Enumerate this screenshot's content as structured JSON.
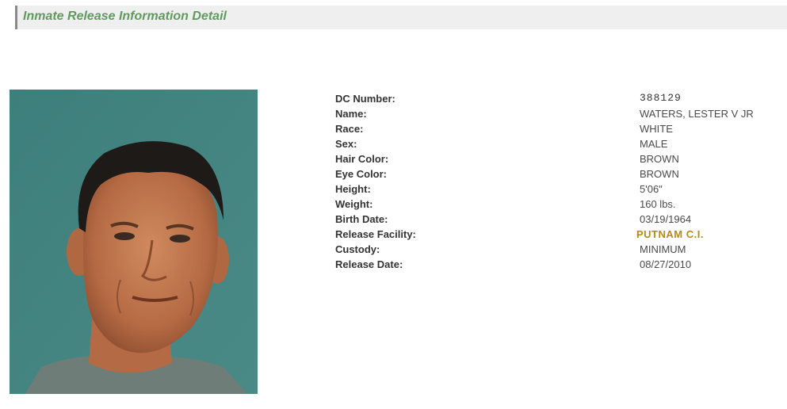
{
  "header": {
    "title": "Inmate Release Information Detail"
  },
  "photo": {
    "alt": "Inmate photo"
  },
  "details": {
    "dc_number": {
      "label": "DC Number:",
      "value": "388129"
    },
    "name": {
      "label": "Name:",
      "value": "WATERS, LESTER V JR"
    },
    "race": {
      "label": "Race:",
      "value": "WHITE"
    },
    "sex": {
      "label": "Sex:",
      "value": "MALE"
    },
    "hair_color": {
      "label": "Hair Color:",
      "value": "BROWN"
    },
    "eye_color": {
      "label": "Eye Color:",
      "value": "BROWN"
    },
    "height": {
      "label": "Height:",
      "value": "5'06\""
    },
    "weight": {
      "label": "Weight:",
      "value": "160 lbs."
    },
    "birth_date": {
      "label": "Birth Date:",
      "value": "03/19/1964"
    },
    "release_facility": {
      "label": "Release Facility:",
      "value": "PUTNAM C.I."
    },
    "custody": {
      "label": "Custody:",
      "value": "MINIMUM"
    },
    "release_date": {
      "label": "Release Date:",
      "value": "08/27/2010"
    }
  },
  "colors": {
    "header_title": "#5f9a5f",
    "facility_link": "#b58a16",
    "photo_background": "#3f827e"
  }
}
